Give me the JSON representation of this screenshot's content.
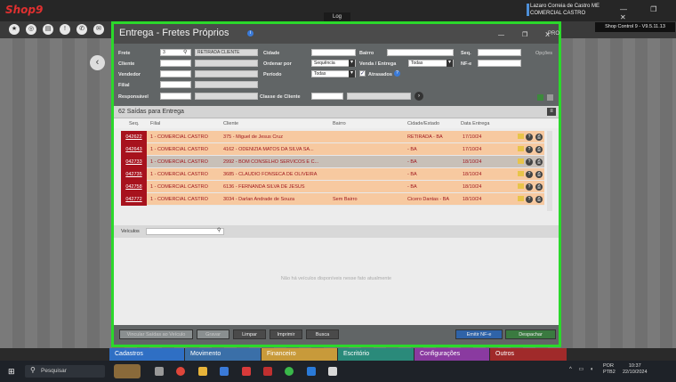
{
  "app": {
    "logo": "Shop9",
    "log_tab": "Log",
    "user_name": "Lazaro Correia de Castro ME",
    "company": "COMERCIAL CASTRO",
    "version": "Shop Control 9 - V9.5.11.13",
    "window_controls": "— ❐ ✕"
  },
  "dialog": {
    "title": "Entrega - Fretes Próprios",
    "help_icon": "info-icon",
    "controls": "— ❐ X",
    "pro_label": "PRO"
  },
  "filters": {
    "frete_label": "Frete",
    "frete_value": "3",
    "frete_desc": "RETIRADA CLIENTE",
    "cliente_label": "Cliente",
    "vendedor_label": "Vendedor",
    "filial_label": "Filial",
    "responsavel_label": "Responsável",
    "cidade_label": "Cidade",
    "bairro_label": "Bairro",
    "seq_label": "Seq.",
    "opcoes_label": "Opções",
    "ordenar_label": "Ordenar por",
    "ordenar_value": "Sequência",
    "venda_label": "Venda / Entrega",
    "venda_value": "Todas",
    "nfe_label": "NF-e",
    "periodo_label": "Período",
    "periodo_value": "Todas",
    "atrasados_label": "Atrasados",
    "classe_label": "Classe de Cliente"
  },
  "list": {
    "title": "62 Saídas para Entrega",
    "headers": [
      "Seq.",
      "Filial",
      "Cliente",
      "Bairro",
      "Cidade/Estado",
      "Data Entrega"
    ],
    "rows": [
      {
        "seq": "042622",
        "filial": "1 - COMERCIAL CASTRO",
        "cliente": "375 - Miguel de Jesus Cruz",
        "bairro": "",
        "cidade": "RETIRADA - BA",
        "data": "17/10/24"
      },
      {
        "seq": "042643",
        "filial": "1 - COMERCIAL CASTRO",
        "cliente": "4162 - ODENIZIA MATOS DA SILVA SA...",
        "bairro": "",
        "cidade": "- BA",
        "data": "17/10/24"
      },
      {
        "seq": "042733",
        "filial": "1 - COMERCIAL CASTRO",
        "cliente": "2992 - BOM CONSELHO SERVICOS E C...",
        "bairro": "",
        "cidade": "- BA",
        "data": "18/10/24"
      },
      {
        "seq": "042735",
        "filial": "1 - COMERCIAL CASTRO",
        "cliente": "3685 - CLAUDIO FONSECA DE OLIVEIRA",
        "bairro": "",
        "cidade": "- BA",
        "data": "18/10/24"
      },
      {
        "seq": "042758",
        "filial": "1 - COMERCIAL CASTRO",
        "cliente": "6136 - FERNANDA SILVA DE JESUS",
        "bairro": "",
        "cidade": "- BA",
        "data": "18/10/24"
      },
      {
        "seq": "042772",
        "filial": "1 - COMERCIAL CASTRO",
        "cliente": "3034 - Darlan Andrade de Souza",
        "bairro": "Sem Bairro",
        "cidade": "Cicero Dantas - BA",
        "data": "18/10/24"
      }
    ]
  },
  "vehicles": {
    "label": "Veículos",
    "empty": "Não há veículos disponíveis nesse fato atualmente"
  },
  "buttons": {
    "vincular": "Vincular Saídas ao Veículo",
    "gravar": "Gravar",
    "limpar": "Limpar",
    "imprimir": "Imprimir",
    "busca": "Busca",
    "emitir": "Emitir NF-e",
    "despachar": "Despachar"
  },
  "modules": [
    {
      "label": "Cadastros",
      "color": "#2f6fc4"
    },
    {
      "label": "Movimento",
      "color": "#3a6fa8"
    },
    {
      "label": "Financeiro",
      "color": "#c89a3a"
    },
    {
      "label": "Escritório",
      "color": "#2a8a7a"
    },
    {
      "label": "Configurações",
      "color": "#8a3aa0"
    },
    {
      "label": "Outros",
      "color": "#a02a2a"
    }
  ],
  "taskbar": {
    "search": "Pesquisar",
    "lang1": "POR",
    "lang2": "PTB2",
    "time": "10:37",
    "date": "22/10/2024"
  }
}
